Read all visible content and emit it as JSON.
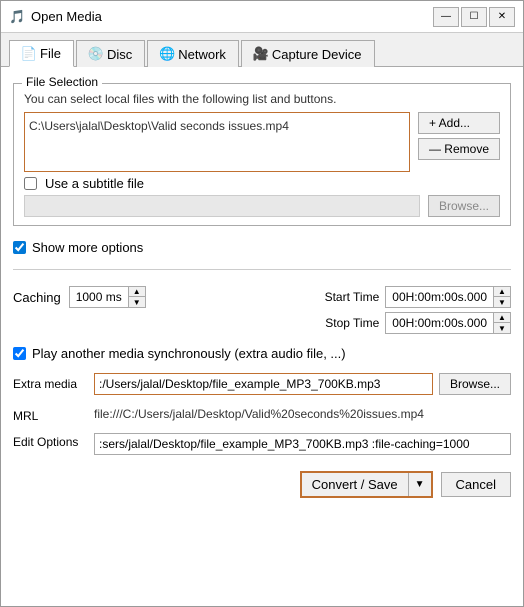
{
  "window": {
    "title": "Open Media",
    "icon": "🎵",
    "min_btn": "—",
    "max_btn": "☐",
    "close_btn": "✕"
  },
  "tabs": [
    {
      "id": "file",
      "label": "File",
      "icon": "📄",
      "active": true
    },
    {
      "id": "disc",
      "label": "Disc",
      "icon": "💿",
      "active": false
    },
    {
      "id": "network",
      "label": "Network",
      "icon": "🌐",
      "active": false
    },
    {
      "id": "capture",
      "label": "Capture Device",
      "icon": "🎥",
      "active": false
    }
  ],
  "file_selection": {
    "group_title": "File Selection",
    "description": "You can select local files with the following list and buttons.",
    "file_path": "C:\\Users\\jalal\\Desktop\\Valid seconds issues.mp4",
    "add_label": "+ Add...",
    "remove_label": "— Remove"
  },
  "subtitle": {
    "checkbox_label": "Use a subtitle file",
    "checked": false,
    "placeholder": "",
    "browse_label": "Browse..."
  },
  "show_more": {
    "checkbox_label": "Show more options",
    "checked": true
  },
  "caching": {
    "label": "Caching",
    "value": "1000 ms"
  },
  "start_time": {
    "label": "Start Time",
    "value": "00H:00m:00s.000"
  },
  "stop_time": {
    "label": "Stop Time",
    "value": "00H:00m:00s.000"
  },
  "play_sync": {
    "checkbox_label": "Play another media synchronously (extra audio file, ...)",
    "checked": true
  },
  "extra_media": {
    "label": "Extra media",
    "value": ":/Users/jalal/Desktop/file_example_MP3_700KB.mp3",
    "browse_label": "Browse..."
  },
  "mrl": {
    "label": "MRL",
    "value": "file:///C:/Users/jalal/Desktop/Valid%20seconds%20issues.mp4"
  },
  "edit_options": {
    "label": "Edit Options",
    "value": ":sers/jalal/Desktop/file_example_MP3_700KB.mp3 :file-caching=1000"
  },
  "buttons": {
    "convert_save": "Convert / Save",
    "cancel": "Cancel"
  }
}
